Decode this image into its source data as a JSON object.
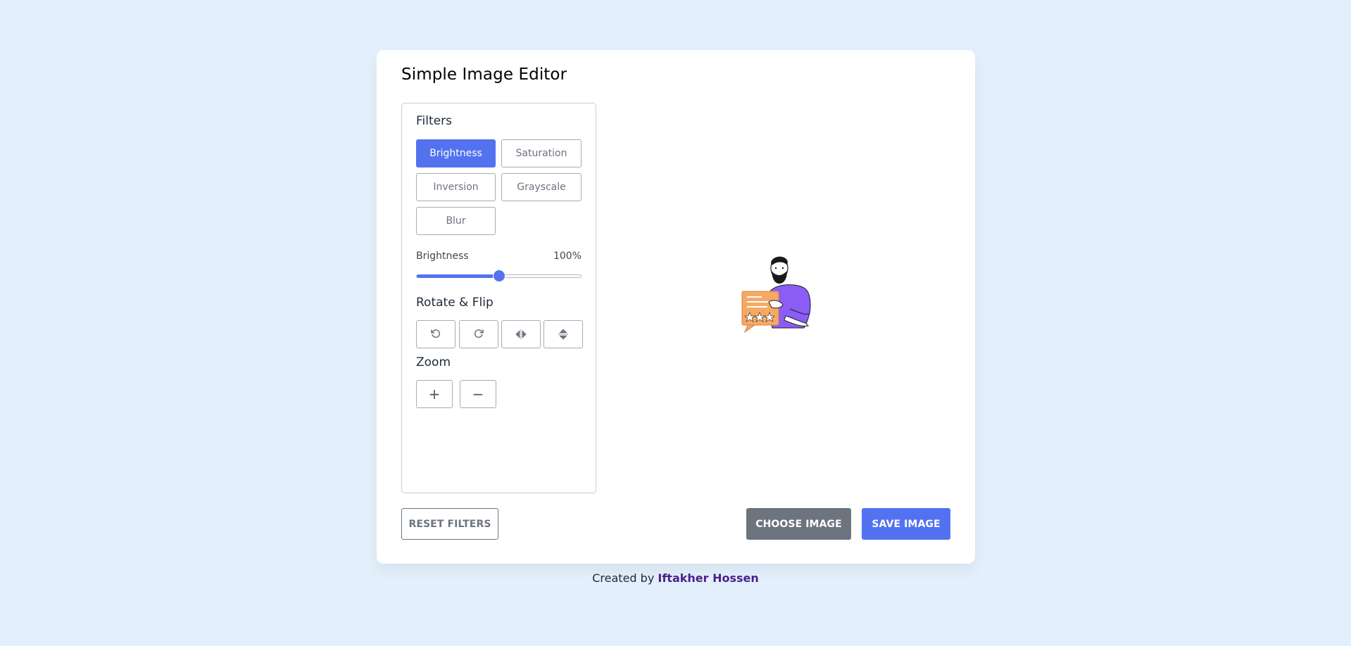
{
  "app": {
    "title": "Simple Image Editor"
  },
  "filters": {
    "title": "Filters",
    "options": [
      {
        "label": "Brightness",
        "active": true
      },
      {
        "label": "Saturation",
        "active": false
      },
      {
        "label": "Inversion",
        "active": false
      },
      {
        "label": "Grayscale",
        "active": false
      },
      {
        "label": "Blur",
        "active": false
      }
    ]
  },
  "slider": {
    "name": "Brightness",
    "value_text": "100%",
    "fraction": 0.5
  },
  "rotate": {
    "title": "Rotate & Flip",
    "buttons": [
      {
        "icon": "rotate-left-icon"
      },
      {
        "icon": "rotate-right-icon"
      },
      {
        "icon": "flip-horizontal-icon"
      },
      {
        "icon": "flip-vertical-icon"
      }
    ]
  },
  "zoom": {
    "title": "Zoom",
    "buttons": [
      {
        "icon": "zoom-in-icon",
        "label": "+"
      },
      {
        "icon": "zoom-out-icon",
        "label": "−"
      }
    ]
  },
  "actions": {
    "reset": "Reset Filters",
    "choose": "Choose Image",
    "save": "Save Image"
  },
  "footer": {
    "prefix": "Created by",
    "author": "Iftakher Hossen"
  },
  "colors": {
    "accent": "#5372f0",
    "secondary": "#6c757d",
    "background": "#e3f0fb",
    "author_link": "#4b1f8c"
  }
}
